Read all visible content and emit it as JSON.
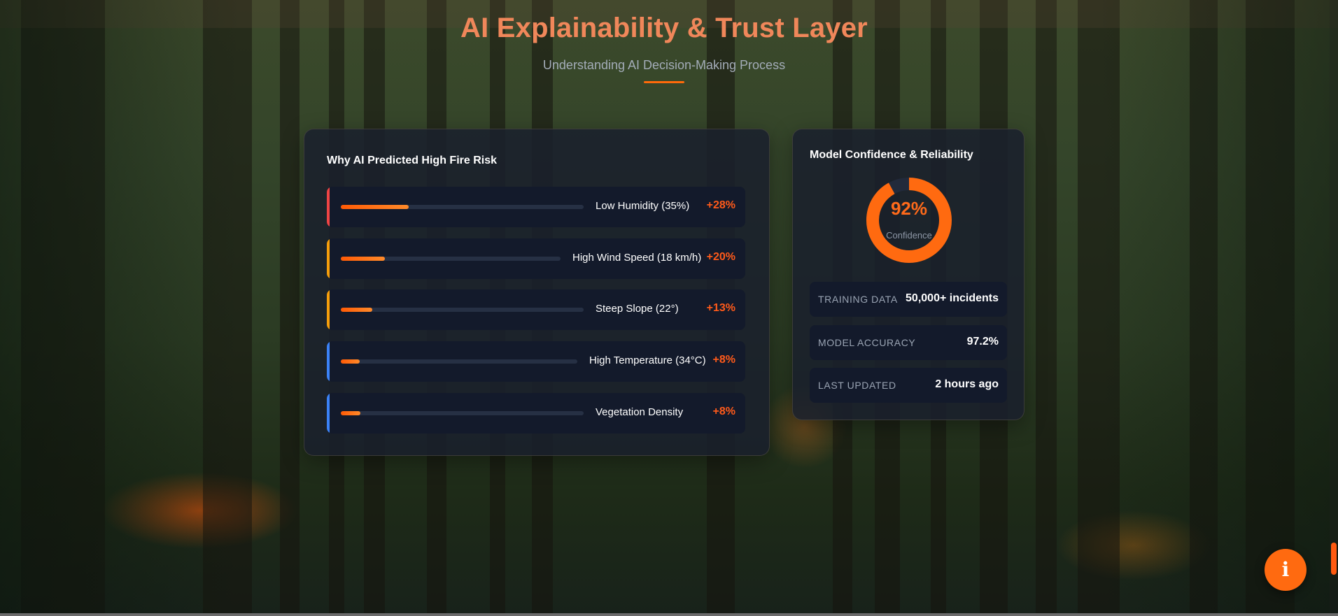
{
  "header": {
    "title": "AI Explainability & Trust Layer",
    "subtitle": "Understanding AI Decision-Making Process"
  },
  "prediction_panel": {
    "title": "Why AI Predicted High Fire Risk",
    "factors": [
      {
        "label": "Low Humidity (35%)",
        "impact": "+28%",
        "bar_fraction": 0.28,
        "accent": "#ef4444"
      },
      {
        "label": "High Wind Speed (18 km/h)",
        "impact": "+20%",
        "bar_fraction": 0.2,
        "accent": "#f59e0b"
      },
      {
        "label": "Steep Slope (22°)",
        "impact": "+13%",
        "bar_fraction": 0.13,
        "accent": "#f59e0b"
      },
      {
        "label": "High Temperature (34°C)",
        "impact": "+8%",
        "bar_fraction": 0.08,
        "accent": "#3b82f6"
      },
      {
        "label": "Vegetation Density",
        "impact": "+8%",
        "bar_fraction": 0.08,
        "accent": "#3b82f6"
      }
    ]
  },
  "confidence_panel": {
    "title": "Model Confidence & Reliability",
    "confidence_value": "92%",
    "confidence_fraction": 0.92,
    "confidence_caption": "Confidence",
    "stats": [
      {
        "label": "TRAINING DATA",
        "value": "50,000+ incidents"
      },
      {
        "label": "MODEL ACCURACY",
        "value": "97.2%"
      },
      {
        "label": "LAST UPDATED",
        "value": "2 hours ago"
      }
    ]
  },
  "fab": {
    "icon": "info-icon",
    "glyph": "i",
    "color": "#ff6a10"
  },
  "colors": {
    "accent": "#ff6a1a",
    "title": "#f0875a",
    "panel": "#1a202c"
  }
}
